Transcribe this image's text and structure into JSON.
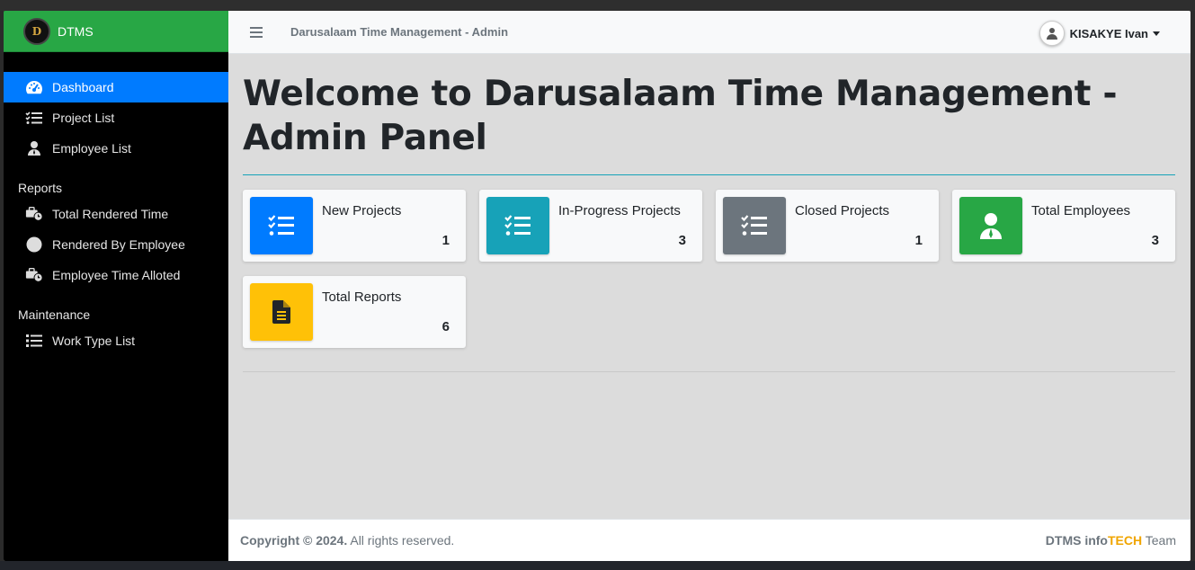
{
  "brand": {
    "logo_text": "D",
    "name": "DTMS"
  },
  "sidebar": {
    "items": [
      {
        "label": "Dashboard",
        "icon": "tachometer-icon",
        "active": true
      },
      {
        "label": "Project List",
        "icon": "tasks-icon"
      },
      {
        "label": "Employee List",
        "icon": "user-tie-icon"
      }
    ],
    "reports_header": "Reports",
    "reports": [
      {
        "label": "Total Rendered Time",
        "icon": "business-time-icon"
      },
      {
        "label": "Rendered By Employee",
        "icon": "circle-icon"
      },
      {
        "label": "Employee Time Alloted",
        "icon": "business-time-icon"
      }
    ],
    "maintenance_header": "Maintenance",
    "maintenance": [
      {
        "label": "Work Type List",
        "icon": "list-icon"
      }
    ]
  },
  "navbar": {
    "title": "Darusalaam Time Management - Admin",
    "user_name": "KISAKYE Ivan"
  },
  "main": {
    "title": "Welcome to Darusalaam Time Management - Admin Panel",
    "cards": [
      {
        "label": "New Projects",
        "value": "1",
        "color": "#007bff",
        "icon": "tasks-icon"
      },
      {
        "label": "In-Progress Projects",
        "value": "3",
        "color": "#17a2b8",
        "icon": "tasks-icon"
      },
      {
        "label": "Closed Projects",
        "value": "1",
        "color": "#6c757d",
        "icon": "tasks-icon"
      },
      {
        "label": "Total Employees",
        "value": "3",
        "color": "#28a745",
        "icon": "user-tie-icon"
      },
      {
        "label": "Total Reports",
        "value": "6",
        "color": "#ffc107",
        "icon": "file-alt-icon"
      }
    ]
  },
  "footer": {
    "copyright": "Copyright © 2024.",
    "rights": " All rights reserved.",
    "team_prefix": "DTMS info",
    "team_tech": "TECH",
    "team_suffix": " Team"
  }
}
